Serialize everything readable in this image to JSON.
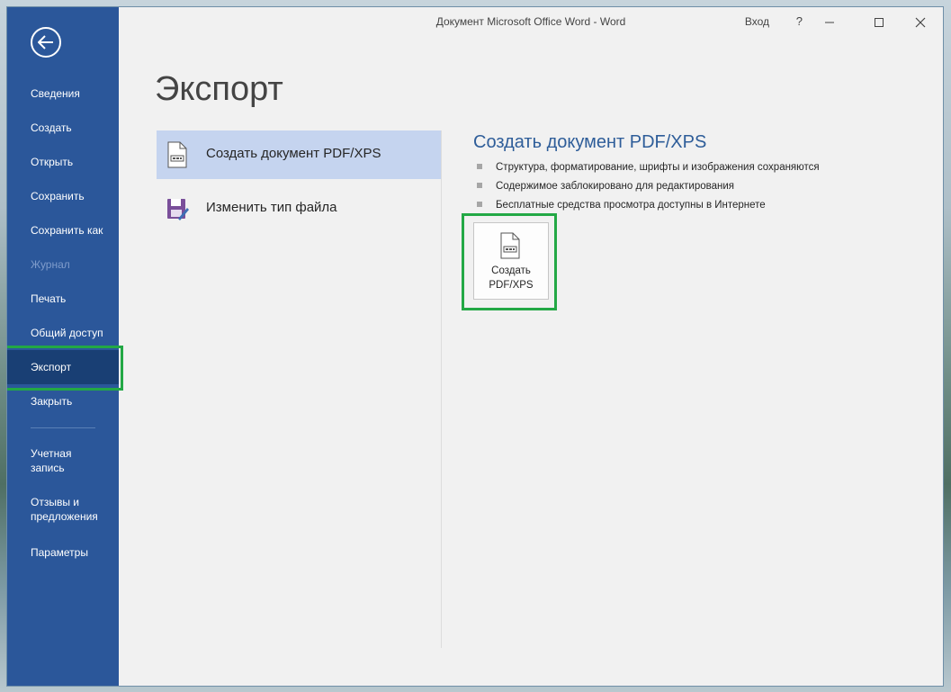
{
  "window": {
    "title": "Документ Microsoft Office Word  -  Word",
    "login": "Вход",
    "help": "?"
  },
  "sidebar": {
    "items": [
      {
        "label": "Сведения",
        "state": "normal"
      },
      {
        "label": "Создать",
        "state": "normal"
      },
      {
        "label": "Открыть",
        "state": "normal"
      },
      {
        "label": "Сохранить",
        "state": "normal"
      },
      {
        "label": "Сохранить как",
        "state": "normal"
      },
      {
        "label": "Журнал",
        "state": "disabled"
      },
      {
        "label": "Печать",
        "state": "normal"
      },
      {
        "label": "Общий доступ",
        "state": "normal"
      },
      {
        "label": "Экспорт",
        "state": "active"
      },
      {
        "label": "Закрыть",
        "state": "normal"
      },
      {
        "label": "Учетная запись",
        "state": "normal"
      },
      {
        "label": "Отзывы и предложения",
        "state": "normal"
      },
      {
        "label": "Параметры",
        "state": "normal"
      }
    ]
  },
  "main": {
    "title": "Экспорт",
    "options": [
      {
        "label": "Создать документ PDF/XPS",
        "icon": "pdf-document-icon",
        "selected": true
      },
      {
        "label": "Изменить тип файла",
        "icon": "save-change-type-icon",
        "selected": false
      }
    ],
    "detail": {
      "title": "Создать документ PDF/XPS",
      "bullets": [
        "Структура, форматирование, шрифты и изображения сохраняются",
        "Содержимое заблокировано для редактирования",
        "Бесплатные средства просмотра доступны в Интернете"
      ],
      "button_line1": "Создать",
      "button_line2": "PDF/XPS"
    }
  },
  "colors": {
    "sidebar": "#2b579a",
    "sidebar_active": "#193f74",
    "selected_option": "#c5d4ef",
    "highlight": "#23a845",
    "accent_title": "#2e5d99"
  }
}
